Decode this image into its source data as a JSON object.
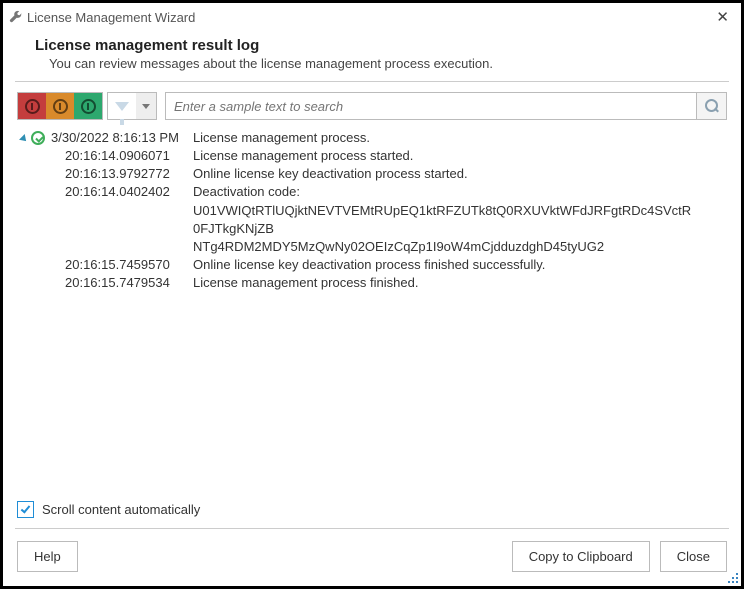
{
  "window": {
    "title": "License Management Wizard"
  },
  "header": {
    "title": "License management result log",
    "subtitle": "You can review messages about the license management process execution."
  },
  "toolbar": {
    "search_placeholder": "Enter a sample text to search"
  },
  "log": {
    "root": {
      "timestamp": "3/30/2022 8:16:13 PM",
      "message": "License management process."
    },
    "entries": [
      {
        "ts": "20:16:14.0906071",
        "msg": "License management process started."
      },
      {
        "ts": "20:16:13.9792772",
        "msg": "Online license key deactivation process started."
      },
      {
        "ts": "20:16:14.0402402",
        "msg": "Deactivation code:\nU01VWIQtRTlUQjktNEVTVEMtRUpEQ1ktRFZUTk8tQ0RXUVktWFdJRFgtRDc4SVctR\n0FJTkgKNjZB\nNTg4RDM2MDY5MzQwNy02OEIzCqZp1I9oW4mCjdduzdghD45tyUG2"
      },
      {
        "ts": "20:16:15.7459570",
        "msg": "Online license key deactivation process finished successfully."
      },
      {
        "ts": "20:16:15.7479534",
        "msg": "License management process finished."
      }
    ]
  },
  "scroll_auto": {
    "label": "Scroll content automatically",
    "checked": true
  },
  "footer": {
    "help": "Help",
    "copy": "Copy to Clipboard",
    "close": "Close"
  }
}
